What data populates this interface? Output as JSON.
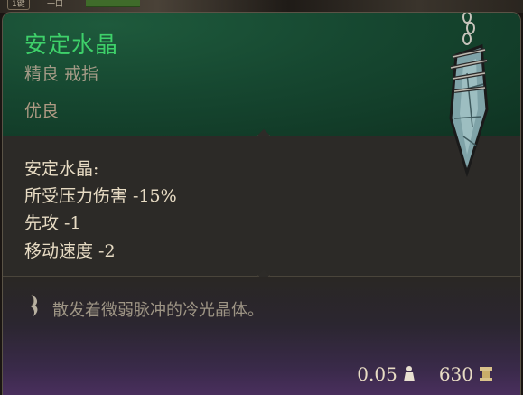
{
  "scene": {
    "tab1": "1键",
    "tab2": "一口"
  },
  "item": {
    "name": "安定水晶",
    "type": "精良 戒指",
    "rarity": "优良",
    "name_color": "#3ed16a"
  },
  "stats": {
    "title": "安定水晶:",
    "lines": [
      "所受压力伤害 -15%",
      "先攻 -1",
      "移动速度 -2"
    ]
  },
  "description": "散发着微弱脉冲的冷光晶体。",
  "footer": {
    "weight": "0.05",
    "weight_icon": "weight-icon",
    "value": "630",
    "value_icon": "gold-icon"
  },
  "icons": {
    "item": "crystal-pendant-icon",
    "description": "quill-icon"
  }
}
